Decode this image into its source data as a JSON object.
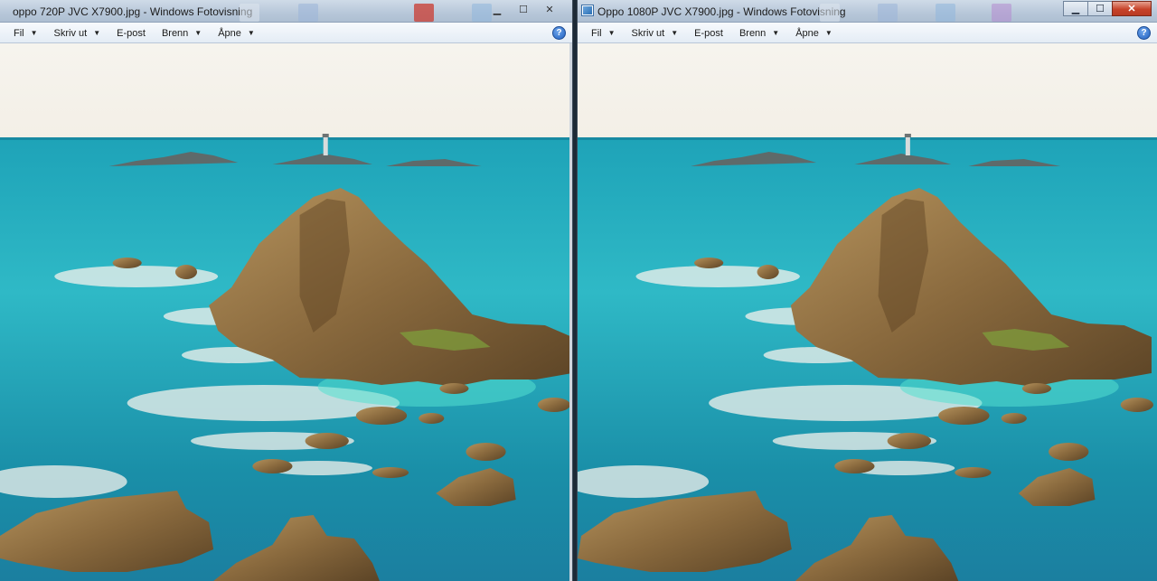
{
  "windows": [
    {
      "title": "oppo 720P JVC X7900.jpg - Windows Fotovisning",
      "menu": [
        {
          "label": "Fil",
          "has_dropdown": true
        },
        {
          "label": "Skriv ut",
          "has_dropdown": true
        },
        {
          "label": "E-post",
          "has_dropdown": false
        },
        {
          "label": "Brenn",
          "has_dropdown": true
        },
        {
          "label": "Åpne",
          "has_dropdown": true
        }
      ],
      "help_icon": "help-icon",
      "caption": {
        "minimize": "▁",
        "maximize": "☐",
        "close": "✕"
      }
    },
    {
      "title": "Oppo 1080P JVC X7900.jpg - Windows Fotovisning",
      "menu": [
        {
          "label": "Fil",
          "has_dropdown": true
        },
        {
          "label": "Skriv ut",
          "has_dropdown": true
        },
        {
          "label": "E-post",
          "has_dropdown": false
        },
        {
          "label": "Brenn",
          "has_dropdown": true
        },
        {
          "label": "Åpne",
          "has_dropdown": true
        }
      ],
      "help_icon": "help-icon",
      "caption": {
        "minimize": "▁",
        "maximize": "☐",
        "close": "✕"
      }
    }
  ],
  "glyphs": {
    "dropdown_arrow": "▼",
    "help": "?"
  },
  "colors": {
    "sky": "#f3efe6",
    "sea_deep": "#1a8fa8",
    "sea_shallow": "#2fb9c6",
    "rock": "#8a6a3e",
    "foam": "#f4f1ec"
  }
}
